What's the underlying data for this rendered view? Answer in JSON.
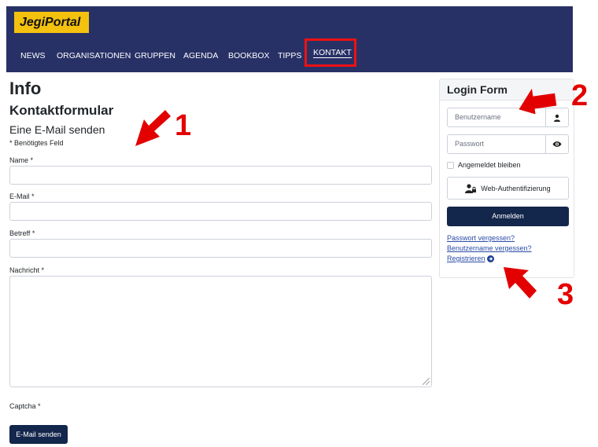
{
  "brand": {
    "logo_text": "JegiPortal"
  },
  "nav": {
    "items": [
      {
        "label": "NEWS"
      },
      {
        "label": "ORGANISATIONEN"
      },
      {
        "label": "GRUPPEN"
      },
      {
        "label": "AGENDA"
      },
      {
        "label": "BOOKBOX"
      },
      {
        "label": "TIPPS"
      },
      {
        "label": "KONTAKT",
        "active": true
      }
    ]
  },
  "main": {
    "heading": "Info",
    "form_title": "Kontaktformular",
    "subheading": "Eine E-Mail senden",
    "required_note": "* Benötigtes Feld",
    "fields": {
      "name_label": "Name *",
      "email_label": "E-Mail *",
      "subject_label": "Betreff *",
      "message_label": "Nachricht *",
      "captcha_label": "Captcha *"
    },
    "send_button": "E-Mail senden"
  },
  "login": {
    "title": "Login Form",
    "username_placeholder": "Benutzername",
    "password_placeholder": "Passwort",
    "remember_label": "Angemeldet bleiben",
    "webauthn_label": "Web-Authentifizierung",
    "submit_label": "Anmelden",
    "forgot_password": "Passwort vergessen?",
    "forgot_username": "Benutzername vergessen?",
    "register": "Registrieren"
  },
  "annotations": {
    "n1": "1",
    "n2": "2",
    "n3": "3"
  },
  "colors": {
    "header_bg": "#283166",
    "logo_bg": "#f4c10f",
    "button_bg": "#13264b",
    "annotation_red": "#e30000",
    "link": "#2a4ba8"
  },
  "icons": [
    "user-icon",
    "eye-icon",
    "user-lock-icon",
    "arrow-circle-right-icon",
    "arrow-annotation-icon"
  ]
}
